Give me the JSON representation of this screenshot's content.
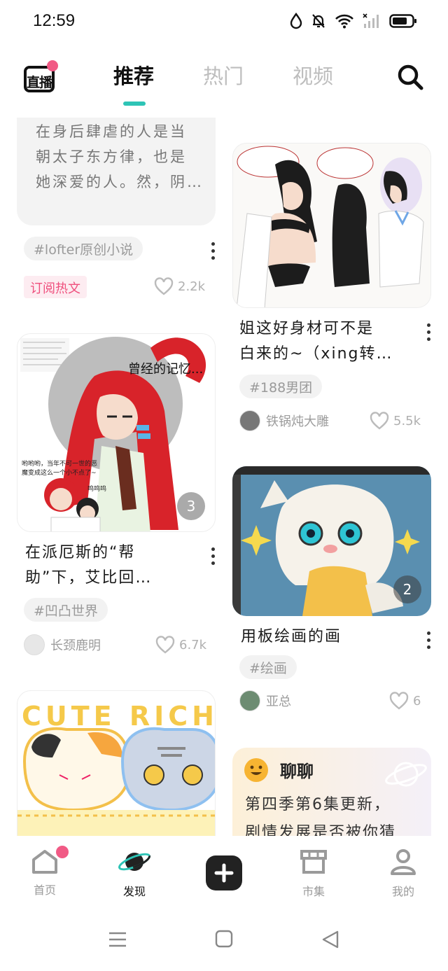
{
  "status": {
    "time": "12:59"
  },
  "topnav": {
    "live_label": "直播",
    "tabs": [
      "推荐",
      "热门",
      "视频"
    ]
  },
  "cards": {
    "c1": {
      "excerpt": [
        "在身后肆虐的人是当",
        "朝太子东方律，也是",
        "她深爱的人。然，阴…"
      ],
      "tag": "#lofter原创小说",
      "label": "订阅热文",
      "likes": "2.2k"
    },
    "c2": {
      "title": [
        "姐这好身材可不是",
        "白来的~（xing转…"
      ],
      "tag": "#188男团",
      "author": "铁锅炖大雕",
      "likes": "5.5k"
    },
    "c3": {
      "bubble": "曾经的记忆...",
      "caption": "哟哟哟，当年不可一世的恶魔变成这么一个小不点了~",
      "small": "呜呜呜",
      "count": "3",
      "title": [
        "在派厄斯的“帮",
        "助”下，艾比回…"
      ],
      "tag": "#凹凸世界",
      "author": "长颈鹿明",
      "likes": "6.7k"
    },
    "c4": {
      "count": "2",
      "title": [
        "用板绘画的画"
      ],
      "tag": "#绘画",
      "author": "亚总",
      "likes": "6"
    },
    "c5": {
      "banner": "CUTE RICH"
    },
    "c6": {
      "header": "聊聊",
      "text": [
        "第四季第6集更新，",
        "剧情发展是否被你猜"
      ]
    }
  },
  "bottomnav": {
    "items": [
      "首页",
      "发现",
      "市集",
      "我的"
    ]
  }
}
